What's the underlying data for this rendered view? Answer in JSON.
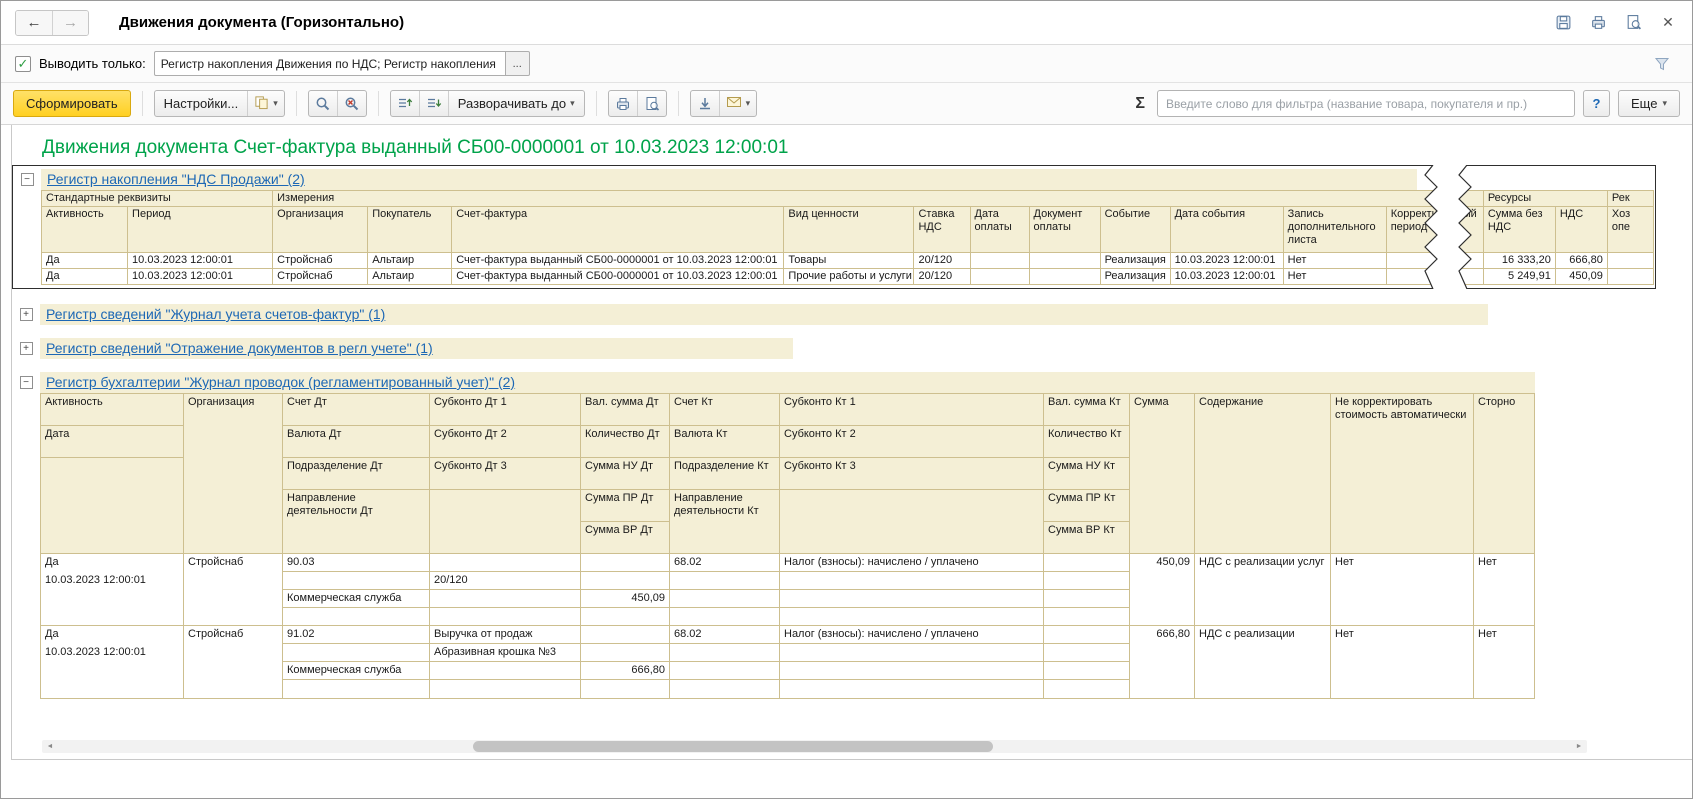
{
  "icons": {
    "back": "←",
    "forward": "→",
    "close": "✕",
    "dropdown": "▾",
    "check": "✓",
    "sigma": "Σ",
    "ellipsis": "...",
    "question": "?",
    "scroll_left": "◄",
    "scroll_right": "►"
  },
  "titlebar": {
    "title": "Движения документа (Горизонтально)"
  },
  "filterbar": {
    "label": "Выводить только:",
    "value": "Регистр накопления Движения по НДС; Регистр накопления НД"
  },
  "toolbar": {
    "generate": "Сформировать",
    "settings": "Настройки...",
    "expand_to": "Разворачивать до",
    "filter_placeholder": "Введите слово для фильтра (название товара, покупателя и пр.)",
    "more": "Еще"
  },
  "colors": {
    "accent_yellow": "#ffd022",
    "header_beige": "#f4efd6",
    "grid_tan": "#cdbf8f",
    "title_green": "#00a34a",
    "link_blue": "#1d68b5"
  },
  "report": {
    "title": "Движения документа Счет-фактура выданный СБ00-0000001 от 10.03.2023 12:00:01",
    "reg1": {
      "toggle": "−",
      "link": "Регистр накопления \"НДС Продажи\" (2)",
      "group_std": "Стандартные реквизиты",
      "group_dim": "Измерения",
      "group_res": "Ресурсы",
      "group_rek": "Рек",
      "h": [
        "Активность",
        "Период",
        "Организация",
        "Покупатель",
        "Счет-фактура",
        "Вид ценности",
        "Ставка НДС",
        "Дата оплаты",
        "Документ оплаты",
        "Событие",
        "Дата события",
        "Запись дополнительного листа",
        "Корректируемый период",
        "Сумма без НДС",
        "НДС",
        "Хоз опе"
      ],
      "rows": [
        [
          "Да",
          "10.03.2023 12:00:01",
          "Стройснаб",
          "Альтаир",
          "Счет-фактура выданный СБ00-0000001 от 10.03.2023 12:00:01",
          "Товары",
          "20/120",
          "",
          "",
          "Реализация",
          "10.03.2023 12:00:01",
          "Нет",
          "",
          "16 333,20",
          "666,80",
          ""
        ],
        [
          "Да",
          "10.03.2023 12:00:01",
          "Стройснаб",
          "Альтаир",
          "Счет-фактура выданный СБ00-0000001 от 10.03.2023 12:00:01",
          "Прочие работы и услуги",
          "20/120",
          "",
          "",
          "Реализация",
          "10.03.2023 12:00:01",
          "Нет",
          "",
          "5 249,91",
          "450,09",
          ""
        ]
      ]
    },
    "reg2": {
      "toggle": "+",
      "link": "Регистр сведений \"Журнал учета счетов-фактур\" (1)"
    },
    "reg3": {
      "toggle": "+",
      "link": "Регистр сведений \"Отражение документов в регл учете\" (1)"
    },
    "reg4": {
      "toggle": "−",
      "link": "Регистр бухгалтерии \"Журнал проводок (регламентированный учет)\" (2)",
      "hc1": [
        "Активность",
        "Дата"
      ],
      "hc2": "Организация",
      "hc3": [
        "Счет Дт",
        "Валюта Дт",
        "Подразделение Дт",
        "Направление деятельности Дт"
      ],
      "hc4": [
        "Субконто Дт 1",
        "Субконто Дт 2",
        "Субконто Дт 3"
      ],
      "hc5": [
        "Вал. сумма Дт",
        "Количество Дт",
        "Сумма НУ Дт",
        "Сумма ПР Дт",
        "Сумма ВР Дт"
      ],
      "hc6": [
        "Счет Кт",
        "Валюта Кт",
        "Подразделение Кт",
        "Направление деятельности Кт"
      ],
      "hc7": [
        "Субконто Кт 1",
        "Субконто Кт 2",
        "Субконто Кт 3"
      ],
      "hc8": [
        "Вал. сумма Кт",
        "Количество Кт",
        "Сумма НУ Кт",
        "Сумма ПР Кт",
        "Сумма ВР Кт"
      ],
      "hc9": "Сумма",
      "hc10": "Содержание",
      "hc11": "Не корректировать стоимость автоматически",
      "hc12": "Сторно",
      "records": [
        {
          "c1": [
            "Да",
            "10.03.2023 12:00:01"
          ],
          "c2": "Стройснаб",
          "c3": [
            "90.03",
            "",
            "Коммерческая служба",
            ""
          ],
          "c4": [
            "",
            "20/120",
            "",
            ""
          ],
          "c5": [
            "",
            "",
            "450,09",
            ""
          ],
          "c6": [
            "68.02",
            "",
            "",
            ""
          ],
          "c7": [
            "Налог (взносы): начислено / уплачено",
            "",
            "",
            ""
          ],
          "c8": [
            "",
            "",
            "",
            ""
          ],
          "c9": "450,09",
          "c10": "НДС с реализации услуг",
          "c11": "Нет",
          "c12": "Нет"
        },
        {
          "c1": [
            "Да",
            "10.03.2023 12:00:01"
          ],
          "c2": "Стройснаб",
          "c3": [
            "91.02",
            "",
            "Коммерческая служба",
            ""
          ],
          "c4": [
            "Выручка от продаж",
            "Абразивная крошка №3",
            "",
            ""
          ],
          "c5": [
            "",
            "",
            "666,80",
            ""
          ],
          "c6": [
            "68.02",
            "",
            "",
            ""
          ],
          "c7": [
            "Налог (взносы): начислено / уплачено",
            "",
            "",
            ""
          ],
          "c8": [
            "",
            "",
            "",
            ""
          ],
          "c9": "666,80",
          "c10": "НДС с реализации",
          "c11": "Нет",
          "c12": "Нет"
        }
      ]
    }
  }
}
